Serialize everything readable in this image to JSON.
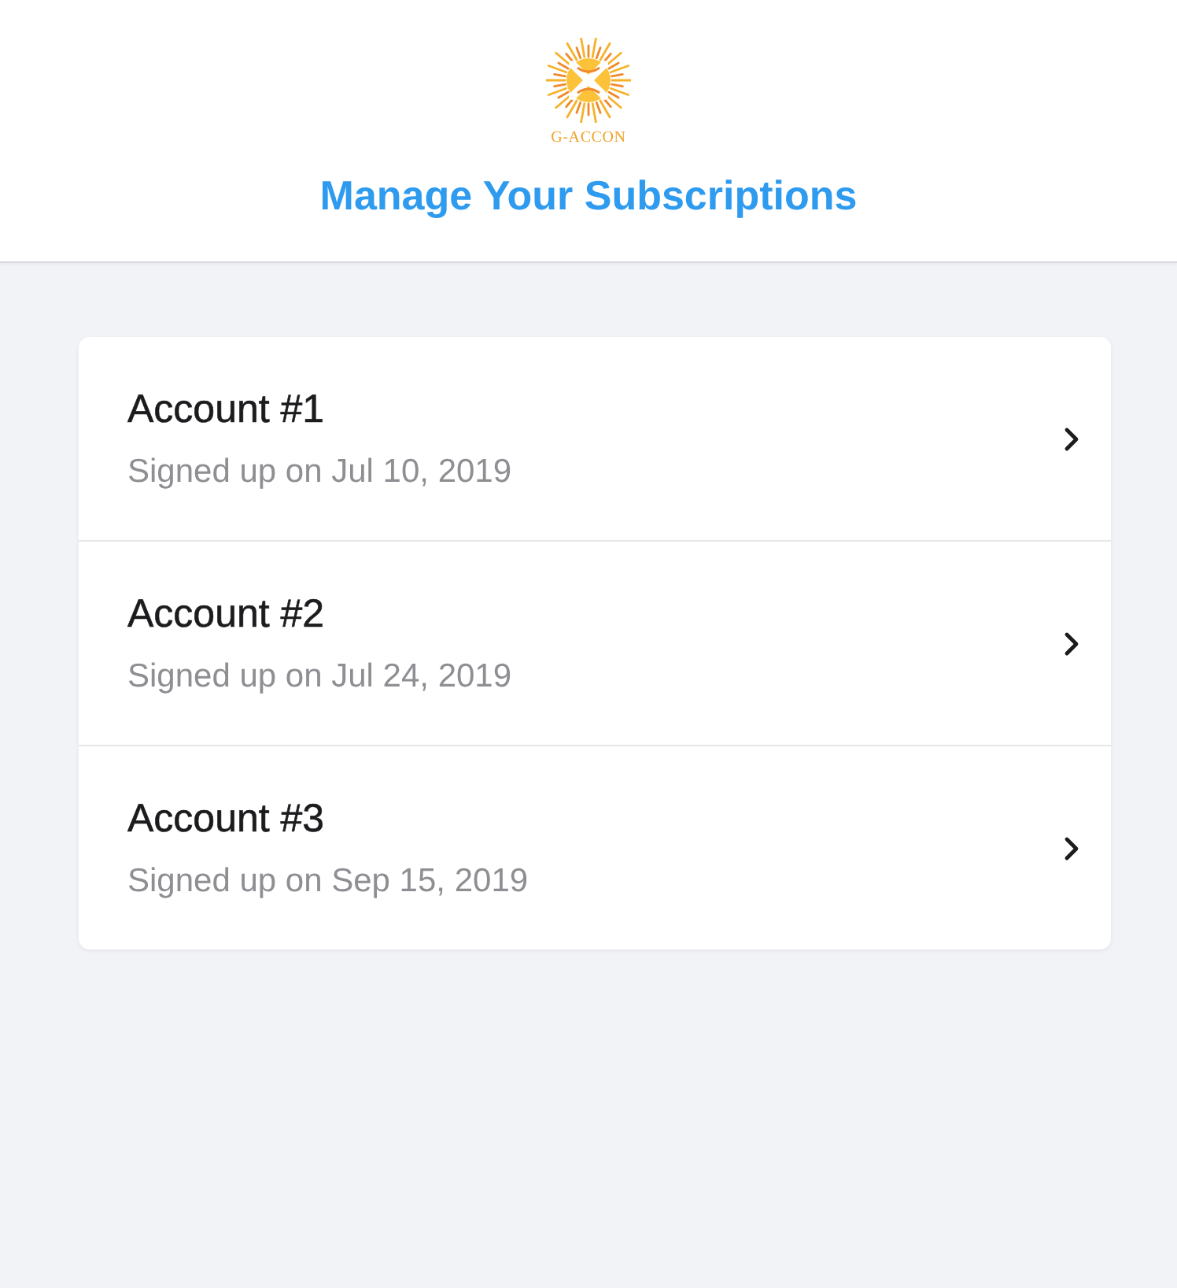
{
  "header": {
    "logo_text": "G-ACCON",
    "title": "Manage Your Subscriptions"
  },
  "accounts": [
    {
      "name": "Account #1",
      "signed_up": "Signed up on Jul 10, 2019"
    },
    {
      "name": "Account #2",
      "signed_up": "Signed up on Jul 24, 2019"
    },
    {
      "name": "Account #3",
      "signed_up": "Signed up on Sep 15, 2019"
    }
  ]
}
